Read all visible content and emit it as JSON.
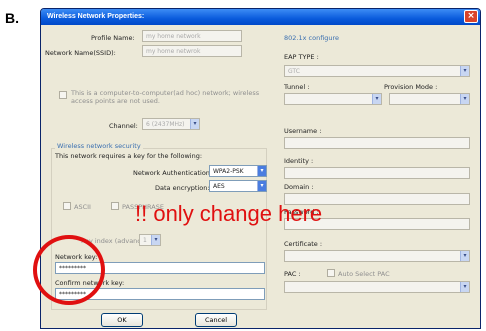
{
  "figure_label": "B.",
  "window": {
    "title": "Wireless Network Properties:",
    "close_glyph": "×"
  },
  "left": {
    "profile_name_label": "Profile Name:",
    "profile_name_value": "my home network",
    "ssid_label": "Network Name(SSID):",
    "ssid_value": "my home netwrok",
    "adhoc_text": "This is a computer-to-computer(ad hoc) network; wireless access points are not used.",
    "channel_label": "Channel:",
    "channel_value": "6 (2437MHz)",
    "security_group_label": "Wireless network security",
    "requires_key_text": "This network requires a key for the following:",
    "auth_label": "Network Authentication:",
    "auth_value": "WPA2-PSK",
    "encryption_label": "Data encryption:",
    "encryption_value": "AES",
    "ascii_label": "ASCII",
    "passphrase_label": "PASSPHRASE",
    "key_index_label": "Key index (advanced):",
    "key_index_value": "1",
    "network_key_label": "Network key:",
    "network_key_value": "*********",
    "confirm_key_label": "Confirm network key:",
    "confirm_key_value": "*********"
  },
  "right": {
    "section_label": "802.1x configure",
    "eap_type_label": "EAP TYPE :",
    "eap_type_value": "GTC",
    "tunnel_label": "Tunnel :",
    "provision_label": "Provision Mode :",
    "username_label": "Username :",
    "identity_label": "Identity :",
    "domain_label": "Domain :",
    "password_label": "Password :",
    "certificate_label": "Certificate :",
    "pac_label": "PAC :",
    "auto_select_pac_label": "Auto Select PAC"
  },
  "buttons": {
    "ok_label": "OK",
    "cancel_label": "Cancel"
  },
  "annotation": {
    "text": "!! only change here",
    "color": "#e01010"
  }
}
